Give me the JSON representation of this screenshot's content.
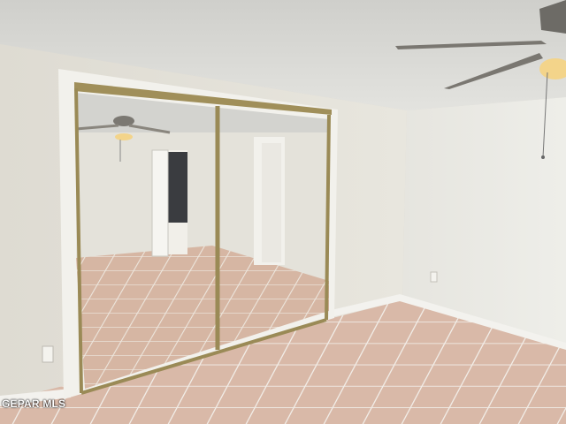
{
  "image": {
    "watermark_text": "GEPAR MLS",
    "colors": {
      "ceiling": "#dcdcd8",
      "wall_left": "#e6e4dc",
      "wall_right": "#e9e8e2",
      "floor_tile": "#d9b9a8",
      "grout": "#f1ece6",
      "mirror_frame": "#9a8a56",
      "baseboard": "#f3f2ee",
      "fan_body": "#6d6b66",
      "fan_light": "#f3d48a"
    },
    "icons": [
      "ceiling-fan-icon",
      "outlet-icon"
    ]
  }
}
